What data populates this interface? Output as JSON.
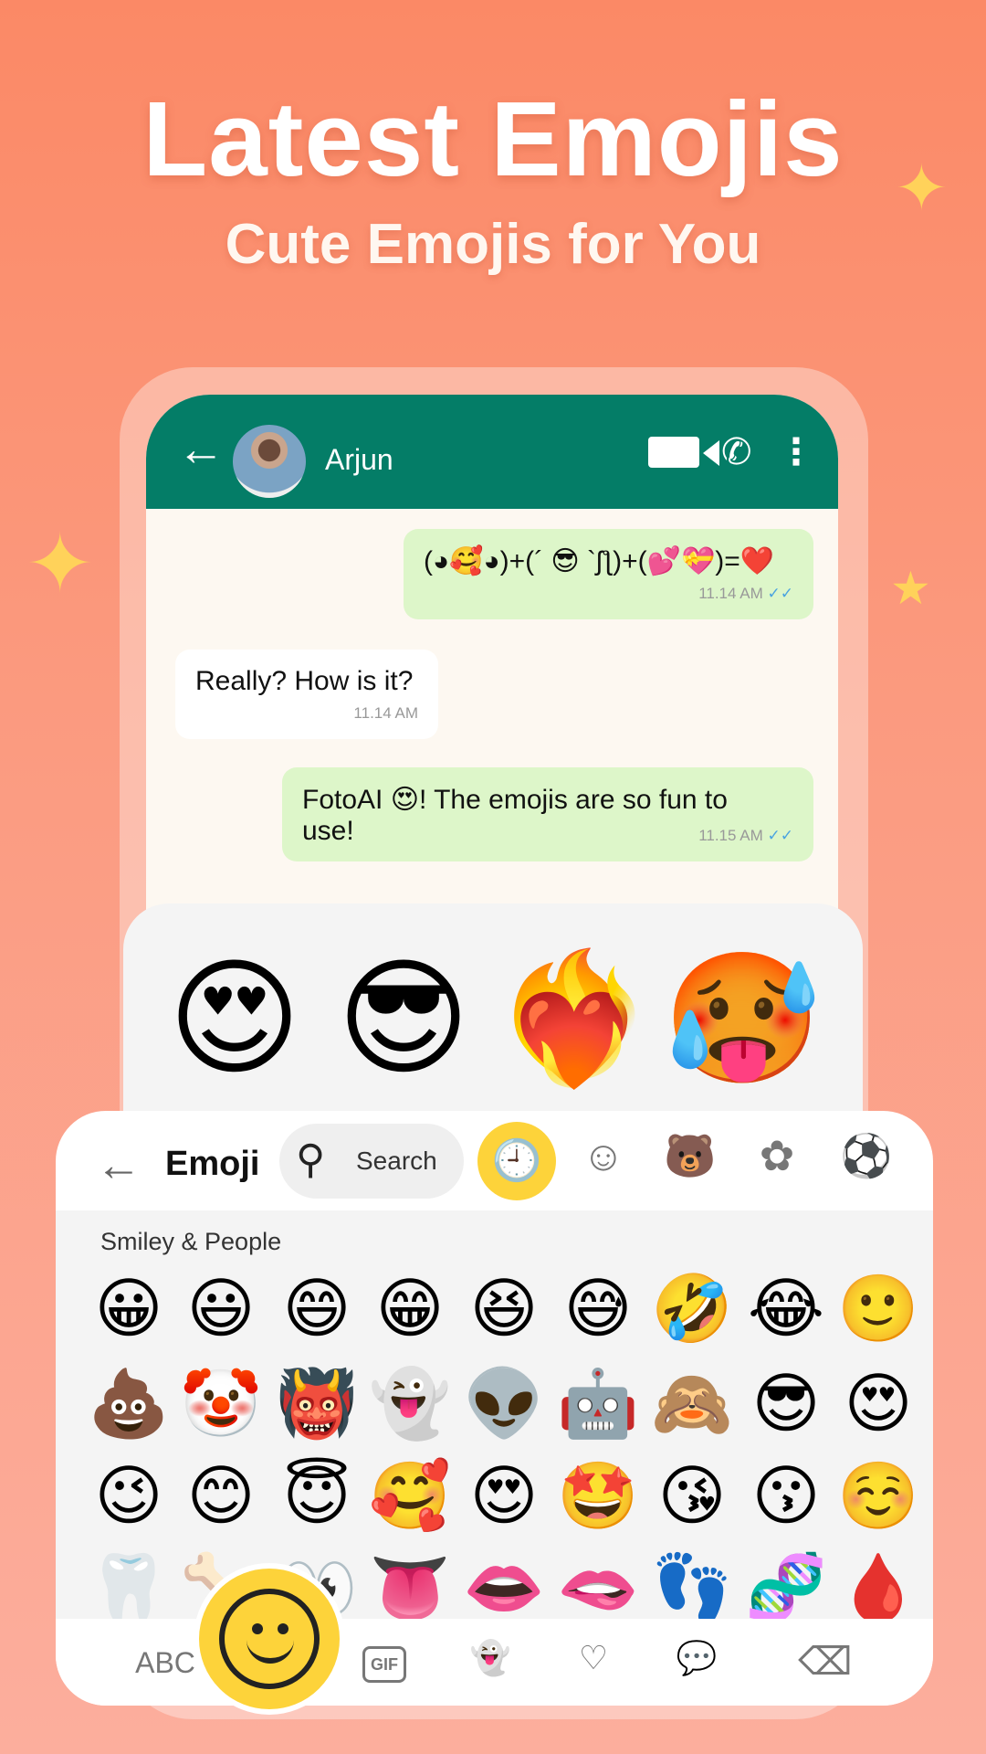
{
  "hero": {
    "title": "Latest Emojis",
    "subtitle": "Cute Emojis for You"
  },
  "chat": {
    "contact_name": "Arjun",
    "back_icon": "←",
    "video_icon": "■◀",
    "call_icon": "✆",
    "menu_icon": "⋮",
    "messages": [
      {
        "direction": "out",
        "text": "(◕🥰◕)+(´ 😎 `ʃƪ)+(💕💝)=❤️",
        "time": "11.14 AM",
        "ticks": "✓✓"
      },
      {
        "direction": "in",
        "text": "Really? How is it?",
        "time": "11.14 AM"
      },
      {
        "direction": "out",
        "text": "FotoAI 😍! The emojis are so fun to use!",
        "time": "11.15 AM",
        "ticks": "✓✓"
      }
    ]
  },
  "featured_emojis": [
    "😍",
    "😎",
    "❤️‍🔥",
    "🥵"
  ],
  "keyboard": {
    "back_icon": "←",
    "title": "Emoji",
    "search_icon": "⚲",
    "search_placeholder": "Search",
    "categories": [
      {
        "name": "recent",
        "glyph": "🕘",
        "active": true
      },
      {
        "name": "smileys",
        "glyph": "☺"
      },
      {
        "name": "animals",
        "glyph": "🐻"
      },
      {
        "name": "nature",
        "glyph": "✿"
      },
      {
        "name": "sports",
        "glyph": "⚽"
      }
    ],
    "section_label": "Smiley & People",
    "rows": [
      [
        "😀",
        "😃",
        "😄",
        "😁",
        "😆",
        "😅",
        "🤣",
        "😂",
        "🙂"
      ],
      [
        "💩",
        "🤡",
        "👹",
        "👻",
        "👽",
        "🤖",
        "🙈",
        "😎",
        "😍"
      ],
      [
        "😉",
        "😊",
        "😇",
        "🥰",
        "😍",
        "🤩",
        "😘",
        "😗",
        "☺️"
      ],
      [
        "🦷",
        "🦴",
        "👀",
        "👅",
        "👄",
        "🫦",
        "👣",
        "🧬",
        "🩸"
      ]
    ],
    "bottom": {
      "abc": "ABC",
      "gif": "GIF",
      "sticker_icon": "👻",
      "heart_bubble_icon": "♡",
      "chat_icon": "💬",
      "delete_icon": "⌫"
    },
    "accent": "#fdd33a"
  },
  "colors": {
    "header_green": "#047d67",
    "out_bubble": "#ddf6c9",
    "background_top": "#fb8966"
  }
}
